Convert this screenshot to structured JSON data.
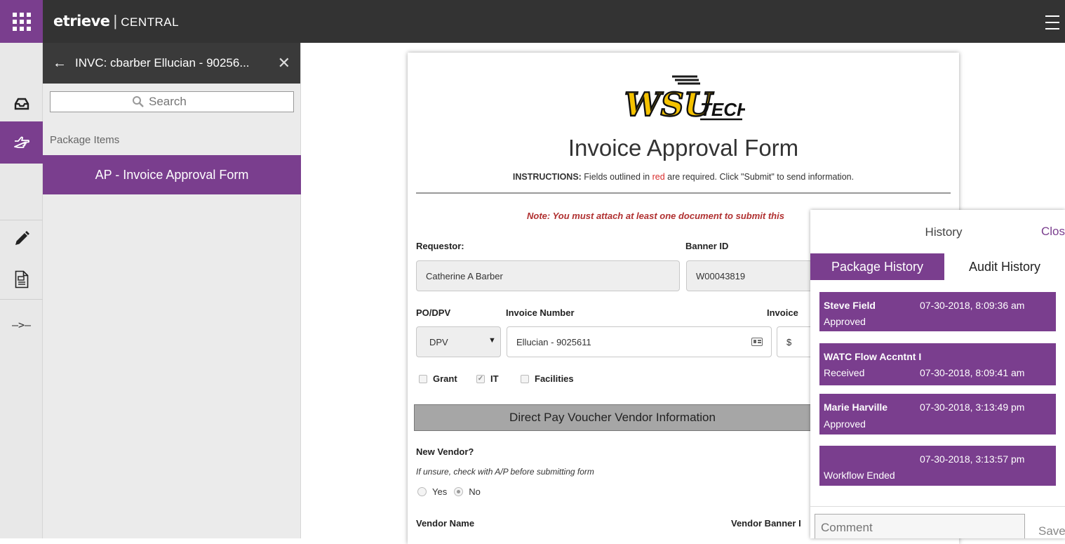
{
  "app": {
    "brand_main": "etrieve",
    "brand_separator": "|",
    "brand_sub": "CENTRAL"
  },
  "package": {
    "title": "INVC: cbarber Ellucian - 90256...",
    "search_placeholder": "Search",
    "items_label": "Package Items",
    "items": [
      {
        "label": "AP - Invoice Approval Form"
      }
    ]
  },
  "form": {
    "logo_main": "WSU",
    "logo_sub": "TECH",
    "title": "Invoice Approval Form",
    "instructions_bold": "INSTRUCTIONS:",
    "instructions_pre": " Fields outlined in ",
    "instructions_red": "red",
    "instructions_post": " are required. Click \"Submit\" to send information.",
    "note": "Note: You must attach at least one document to submit this",
    "requestor_label": "Requestor:",
    "requestor_value": "Catherine A Barber",
    "banner_id_label": "Banner ID",
    "banner_id_value": "W00043819",
    "po_dpv_label": "PO/DPV",
    "po_dpv_value": "DPV",
    "invoice_number_label": "Invoice Number",
    "invoice_number_value": "Ellucian - 9025611",
    "invoice_amount_label": "Invoice",
    "currency_symbol": "$",
    "checkboxes": [
      {
        "label": "Grant",
        "checked": false
      },
      {
        "label": "IT",
        "checked": true
      },
      {
        "label": "Facilities",
        "checked": false
      }
    ],
    "section_title": "Direct Pay Voucher Vendor Information",
    "new_vendor_label": "New Vendor?",
    "new_vendor_hint": "If unsure, check with A/P before submitting form",
    "radio_yes": "Yes",
    "radio_no": "No",
    "vendor_name_label": "Vendor Name",
    "vendor_banner_label": "Vendor Banner I"
  },
  "history": {
    "title": "History",
    "close_label": "Close",
    "tab_package": "Package History",
    "tab_audit": "Audit History",
    "entries": [
      {
        "name": "Steve Field",
        "date": "07-30-2018, 8:09:36 am",
        "status": "Approved"
      },
      {
        "name": "WATC Flow Accntnt I",
        "date": "07-30-2018, 8:09:41 am",
        "status": "Received"
      },
      {
        "name": "Marie Harville",
        "date": "07-30-2018, 3:13:49 pm",
        "status": "Approved"
      },
      {
        "name": "",
        "date": "07-30-2018, 3:13:57 pm",
        "status": "Workflow Ended"
      }
    ],
    "comment_placeholder": "Comment",
    "save_label": "Save"
  },
  "colors": {
    "accent": "#7a3e8e",
    "topbar": "#333333",
    "note_red": "#b03030"
  }
}
